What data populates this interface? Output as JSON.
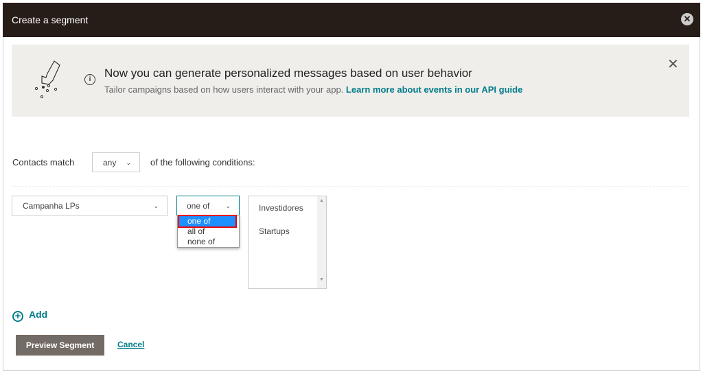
{
  "modal": {
    "title": "Create a segment"
  },
  "banner": {
    "heading": "Now you can generate personalized messages based on user behavior",
    "text": "Tailor campaigns based on how users interact with your app. ",
    "link": "Learn more about events in our API guide"
  },
  "match": {
    "prefix": "Contacts match",
    "value": "any",
    "suffix": "of the following conditions:"
  },
  "condition": {
    "field": "Campanha LPs",
    "operator": "one of",
    "operator_options": [
      "one of",
      "all of",
      "none of"
    ],
    "values": [
      "Investidores",
      "Startups"
    ]
  },
  "actions": {
    "add": "Add",
    "preview": "Preview Segment",
    "cancel": "Cancel"
  },
  "colors": {
    "header": "#271d18",
    "accent": "#007c89",
    "highlight": "#1e90ff"
  }
}
